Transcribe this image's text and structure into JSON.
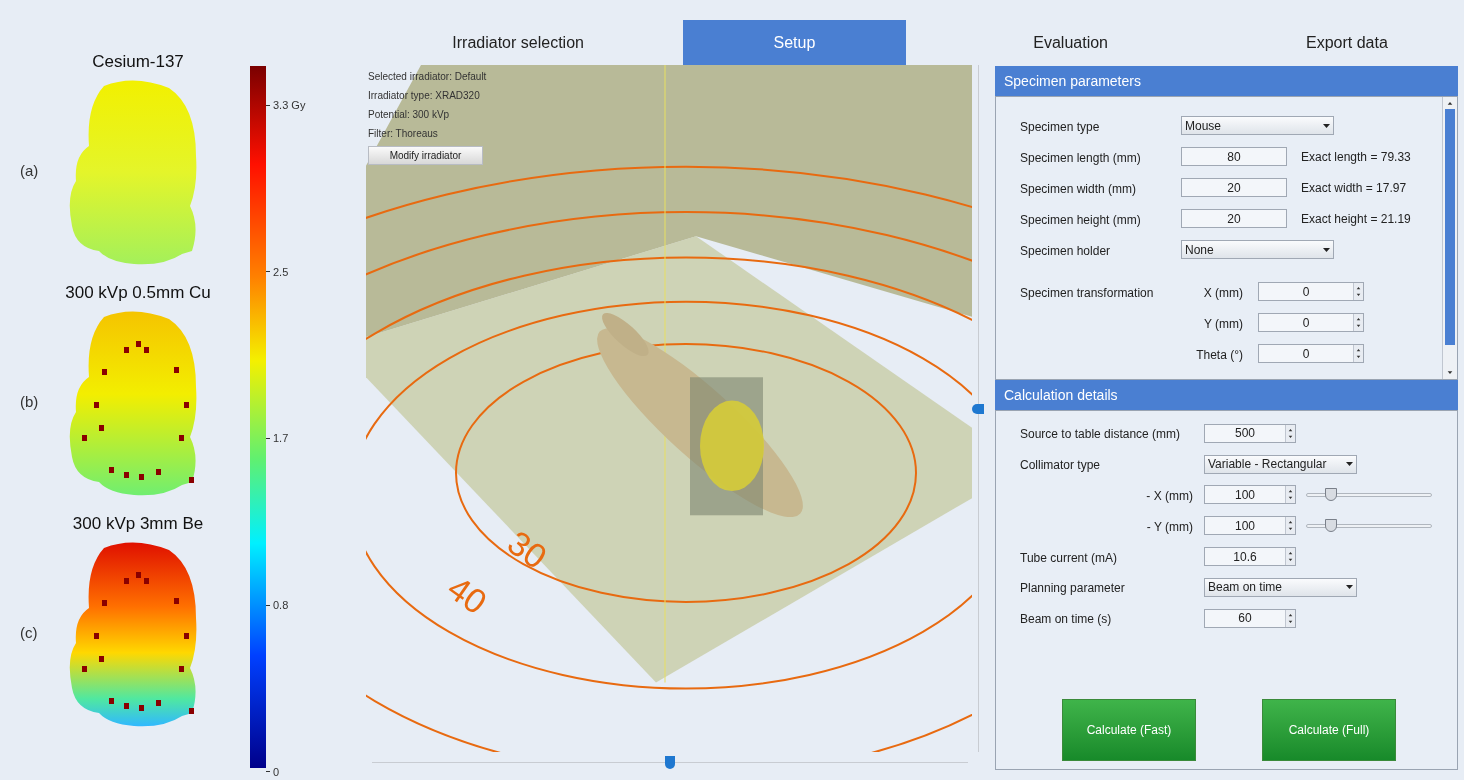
{
  "figure": {
    "maps": [
      {
        "title": "Cesium-137",
        "label": "(a)",
        "kind": "picture"
      },
      {
        "title": "300 kVp 0.5mm Cu",
        "label": "(b)",
        "kind": "picture"
      },
      {
        "title": "300 kVp 3mm Be",
        "label": "(c)",
        "kind": "picture"
      }
    ],
    "colorbar": {
      "ticks": [
        "3.3 Gy",
        "2.5",
        "1.7",
        "0.8",
        "0"
      ]
    }
  },
  "tabs": [
    {
      "label": "Irradiator selection",
      "selected": false
    },
    {
      "label": "Setup",
      "selected": true
    },
    {
      "label": "Evaluation",
      "selected": false
    },
    {
      "label": "Export data",
      "selected": false
    }
  ],
  "viewport": {
    "info": [
      "Selected irradiator: Default",
      "Irradiator type: XRAD320",
      "Potential: 300 kVp",
      "Filter: Thoreaus"
    ],
    "button": "Modify irradiator",
    "ring_labels": [
      "30",
      "40"
    ],
    "vertical_slider": {
      "level": 0.5
    },
    "horizontal_slider": {
      "level": 0.5
    }
  },
  "specimen_panel": {
    "title": "Specimen parameters",
    "rows": [
      {
        "kind": "dropdown",
        "label": "Specimen type",
        "value": "Mouse"
      },
      {
        "kind": "input",
        "label": "Specimen length (mm)",
        "value": "80",
        "note": "Exact length = 79.33"
      },
      {
        "kind": "input",
        "label": "Specimen width (mm)",
        "value": "20",
        "note": "Exact width = 17.97"
      },
      {
        "kind": "input",
        "label": "Specimen height (mm)",
        "value": "20",
        "note": "Exact height = 21.19"
      },
      {
        "kind": "dropdown",
        "label": "Specimen holder",
        "value": "None"
      },
      {
        "kind": "spinner",
        "label": "Specimen transformation",
        "sublabel": "X (mm)",
        "value": "0"
      },
      {
        "kind": "spinner",
        "sublabel": "Y (mm)",
        "value": "0"
      },
      {
        "kind": "spinner",
        "sublabel": "Theta (°)",
        "value": "0"
      }
    ]
  },
  "calc_panel": {
    "title": "Calculation details",
    "rows": [
      {
        "kind": "spinner",
        "label": "Source to table distance (mm)",
        "value": "500"
      },
      {
        "kind": "dropdown",
        "label": "Collimator type",
        "value": "Variable - Rectangular"
      },
      {
        "kind": "spinner_slider",
        "sublabel": "- X (mm)",
        "value": "100",
        "level": 0.2
      },
      {
        "kind": "spinner_slider",
        "sublabel": "- Y (mm)",
        "value": "100",
        "level": 0.2
      },
      {
        "kind": "spinner",
        "label": "Tube current (mA)",
        "value": "10.6"
      },
      {
        "kind": "dropdown",
        "label": "Planning parameter",
        "value": "Beam on time"
      },
      {
        "kind": "spinner",
        "label": "Beam on time (s)",
        "value": "60"
      }
    ]
  },
  "buttons": [
    "Calculate (Fast)",
    "Calculate (Full)"
  ]
}
